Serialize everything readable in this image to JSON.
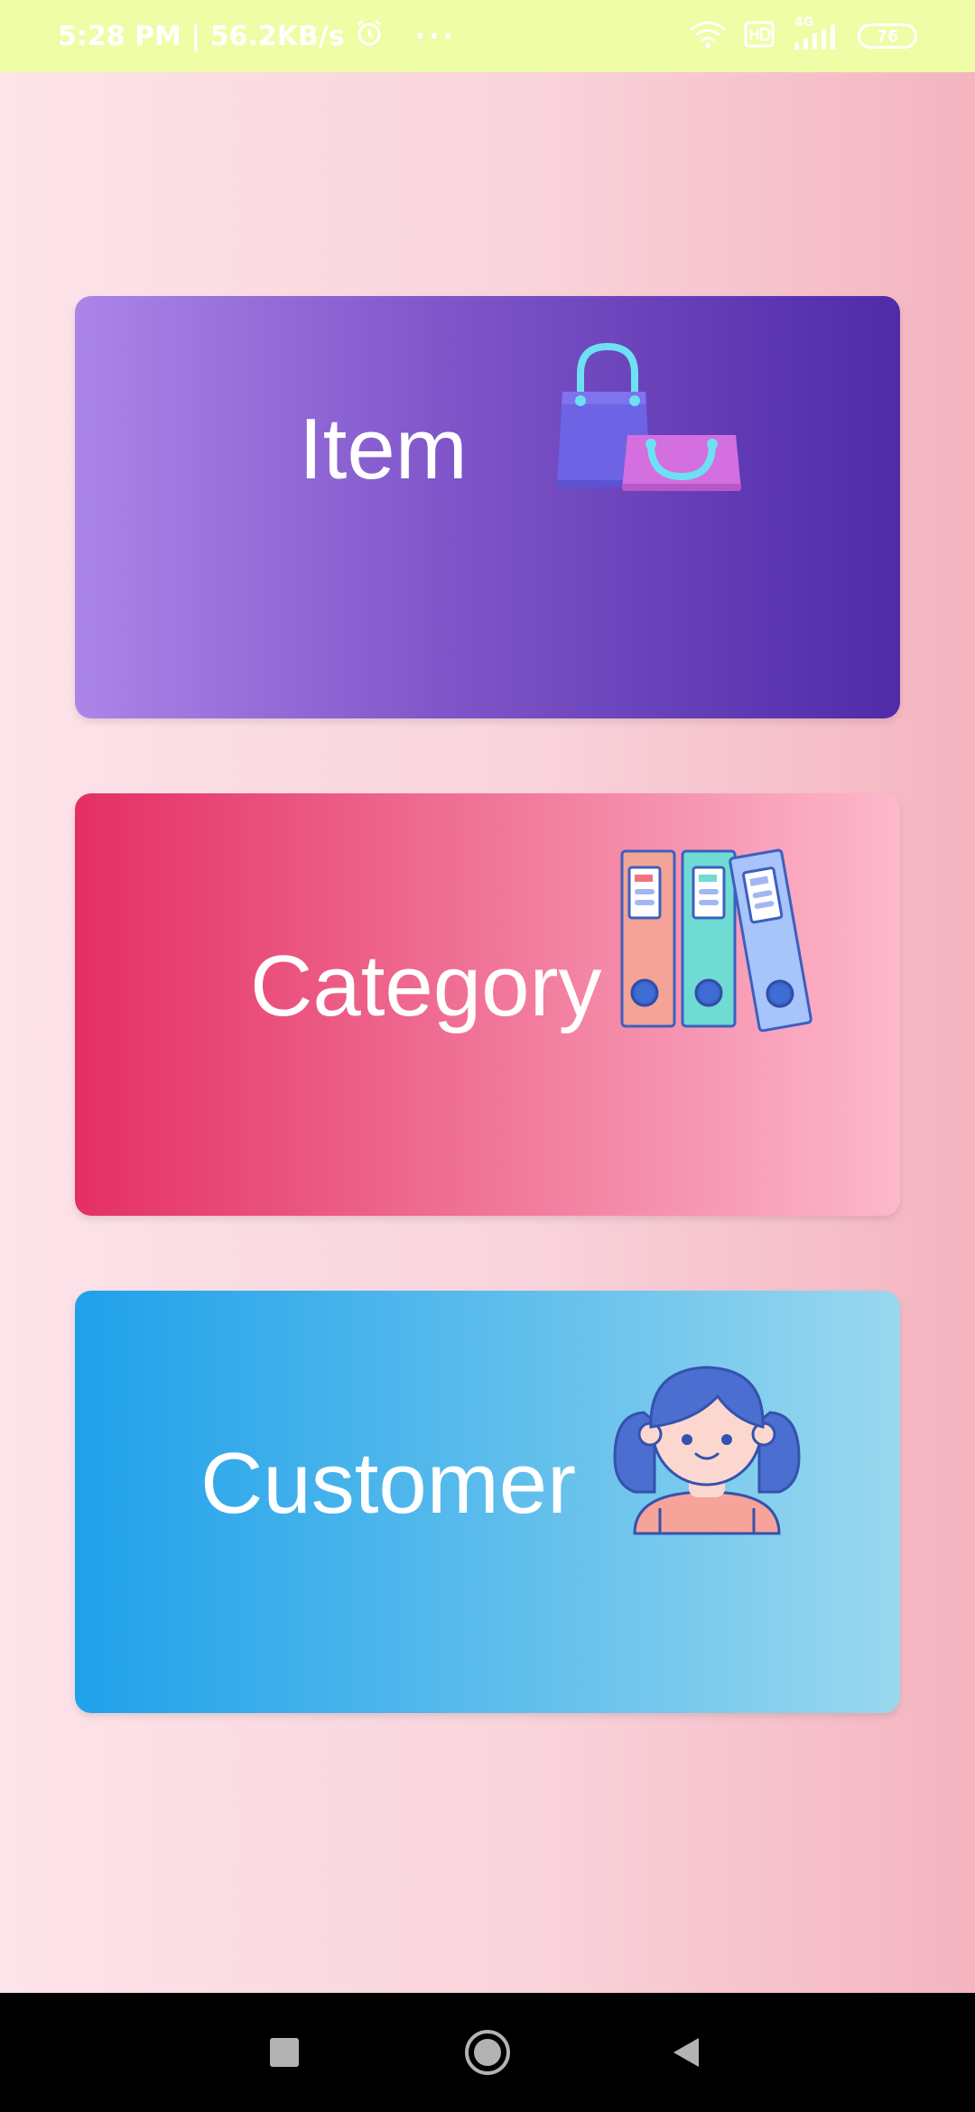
{
  "status_bar": {
    "time_speed": "5:28 PM | 56.2KB/s",
    "more": "···",
    "network": "4G",
    "battery": "76",
    "icons": [
      "alarm-icon",
      "wifi-icon",
      "hd-icon",
      "signal-icon",
      "battery-icon"
    ]
  },
  "cards": {
    "item": {
      "label": "Item",
      "icon": "shopping-bags-icon"
    },
    "category": {
      "label": "Category",
      "icon": "binders-icon"
    },
    "customer": {
      "label": "Customer",
      "icon": "girl-avatar-icon"
    }
  },
  "nav_bar": {
    "buttons": [
      "recents-icon",
      "home-icon",
      "back-icon"
    ]
  },
  "colors": {
    "status_bar_bg": "#eefda6",
    "background_left": "#fde4ea",
    "background_right": "#f4b4c0",
    "item_gradient": [
      "#ab85e8",
      "#4f2ba8"
    ],
    "category_gradient": [
      "#e42f63",
      "#fdb8cc"
    ],
    "customer_gradient": [
      "#1fa1ea",
      "#9ad8ee"
    ]
  }
}
